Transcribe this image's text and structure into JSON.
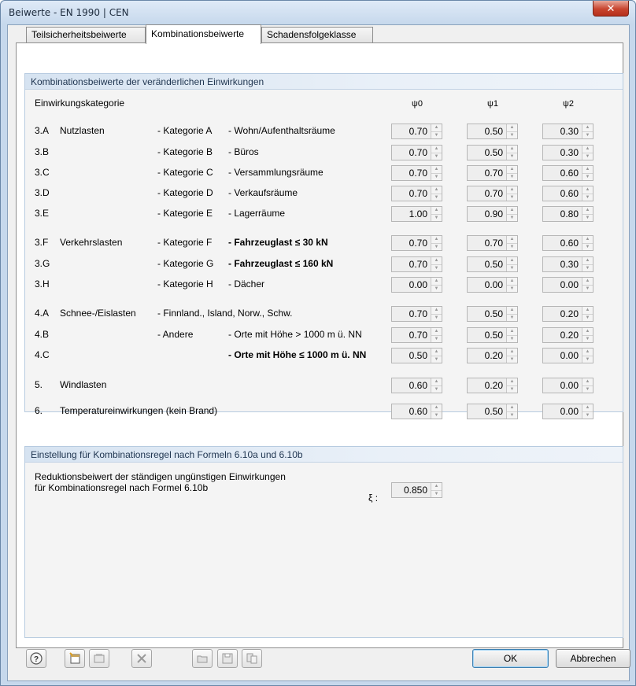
{
  "window": {
    "title": "Beiwerte - EN 1990 | CEN",
    "close_glyph": "✕"
  },
  "tabs": [
    {
      "label": "Teilsicherheitsbeiwerte"
    },
    {
      "label": "Kombinationsbeiwerte"
    },
    {
      "label": "Schadensfolgeklasse"
    }
  ],
  "group1": {
    "title": "Kombinationsbeiwerte der veränderlichen Einwirkungen",
    "column_header": "Einwirkungskategorie",
    "psi_headers": [
      "ψ0",
      "ψ1",
      "ψ2"
    ],
    "rows": [
      {
        "code": "3.A",
        "group": "Nutzlasten",
        "category": "- Kategorie A",
        "desc": "- Wohn/Aufenthaltsräume",
        "psi0": "0.70",
        "psi1": "0.50",
        "psi2": "0.30"
      },
      {
        "code": "3.B",
        "group": "",
        "category": "- Kategorie B",
        "desc": "- Büros",
        "psi0": "0.70",
        "psi1": "0.50",
        "psi2": "0.30"
      },
      {
        "code": "3.C",
        "group": "",
        "category": "- Kategorie C",
        "desc": "- Versammlungsräume",
        "psi0": "0.70",
        "psi1": "0.70",
        "psi2": "0.60"
      },
      {
        "code": "3.D",
        "group": "",
        "category": "- Kategorie D",
        "desc": "- Verkaufsräume",
        "psi0": "0.70",
        "psi1": "0.70",
        "psi2": "0.60"
      },
      {
        "code": "3.E",
        "group": "",
        "category": "- Kategorie E",
        "desc": "- Lagerräume",
        "psi0": "1.00",
        "psi1": "0.90",
        "psi2": "0.80"
      },
      {
        "code": "3.F",
        "group": "Verkehrslasten",
        "category": "- Kategorie F",
        "desc": "- Fahrzeuglast ≤ 30 kN",
        "psi0": "0.70",
        "psi1": "0.70",
        "psi2": "0.60"
      },
      {
        "code": "3.G",
        "group": "",
        "category": "- Kategorie G",
        "desc": "- Fahrzeuglast ≤ 160 kN",
        "psi0": "0.70",
        "psi1": "0.50",
        "psi2": "0.30"
      },
      {
        "code": "3.H",
        "group": "",
        "category": "- Kategorie H",
        "desc": "- Dächer",
        "psi0": "0.00",
        "psi1": "0.00",
        "psi2": "0.00"
      },
      {
        "code": "4.A",
        "group": "Schnee-/Eislasten",
        "category": "- Finnland., Island, Norw., Schw.",
        "desc": "",
        "psi0": "0.70",
        "psi1": "0.50",
        "psi2": "0.20"
      },
      {
        "code": "4.B",
        "group": "",
        "category": "- Andere",
        "desc": "- Orte mit Höhe > 1000 m ü. NN",
        "psi0": "0.70",
        "psi1": "0.50",
        "psi2": "0.20"
      },
      {
        "code": "4.C",
        "group": "",
        "category": "",
        "desc": "- Orte mit Höhe ≤ 1000 m ü. NN",
        "psi0": "0.50",
        "psi1": "0.20",
        "psi2": "0.00"
      },
      {
        "code": "5.",
        "group": "Windlasten",
        "category": "",
        "desc": "",
        "psi0": "0.60",
        "psi1": "0.20",
        "psi2": "0.00"
      },
      {
        "code": "6.",
        "group": "Temperatureinwirkungen (kein Brand)",
        "category": "",
        "desc": "",
        "psi0": "0.60",
        "psi1": "0.50",
        "psi2": "0.00"
      }
    ]
  },
  "group2": {
    "title": "Einstellung für Kombinationsregel nach Formeln 6.10a und 6.10b",
    "line1": "Reduktionsbeiwert der ständigen ungünstigen Einwirkungen",
    "line2": "für Kombinationsregel nach Formel 6.10b",
    "symbol": "ξ :",
    "value": "0.850"
  },
  "buttons": {
    "ok": "OK",
    "cancel": "Abbrechen"
  }
}
